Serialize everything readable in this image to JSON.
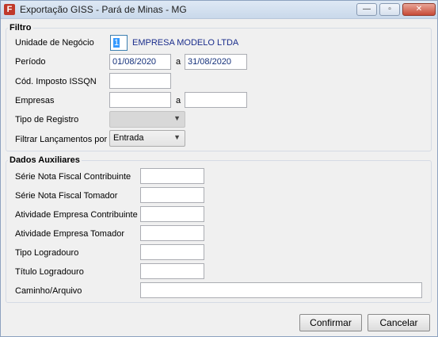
{
  "window": {
    "title": "Exportação GISS - Pará de Minas - MG"
  },
  "filtro": {
    "legend": "Filtro",
    "unidade_label": "Unidade de Negócio",
    "unidade_value": "1",
    "empresa_nome": "EMPRESA MODELO LTDA",
    "periodo_label": "Período",
    "periodo_inicio": "01/08/2020",
    "periodo_sep": "a",
    "periodo_fim": "31/08/2020",
    "cod_imposto_label": "Cód. Imposto ISSQN",
    "cod_imposto_value": "",
    "empresas_label": "Empresas",
    "empresas_inicio": "",
    "empresas_sep": "a",
    "empresas_fim": "",
    "tipo_registro_label": "Tipo de Registro",
    "tipo_registro_value": "",
    "filtrar_label": "Filtrar Lançamentos por",
    "filtrar_value": "Entrada"
  },
  "aux": {
    "legend": "Dados Auxiliares",
    "serie_contrib_label": "Série Nota Fiscal Contribuinte",
    "serie_tomador_label": "Série Nota Fiscal Tomador",
    "ativ_contrib_label": "Atividade Empresa Contribuinte",
    "ativ_tomador_label": "Atividade Empresa Tomador",
    "tipo_logr_label": "Tipo Logradouro",
    "titulo_logr_label": "Título Logradouro",
    "caminho_label": "Caminho/Arquivo"
  },
  "buttons": {
    "confirmar": "Confirmar",
    "cancelar": "Cancelar"
  },
  "icons": {
    "app": "giss-app-icon",
    "minimize": "minimize-icon",
    "maximize": "maximize-icon",
    "close": "close-icon"
  }
}
